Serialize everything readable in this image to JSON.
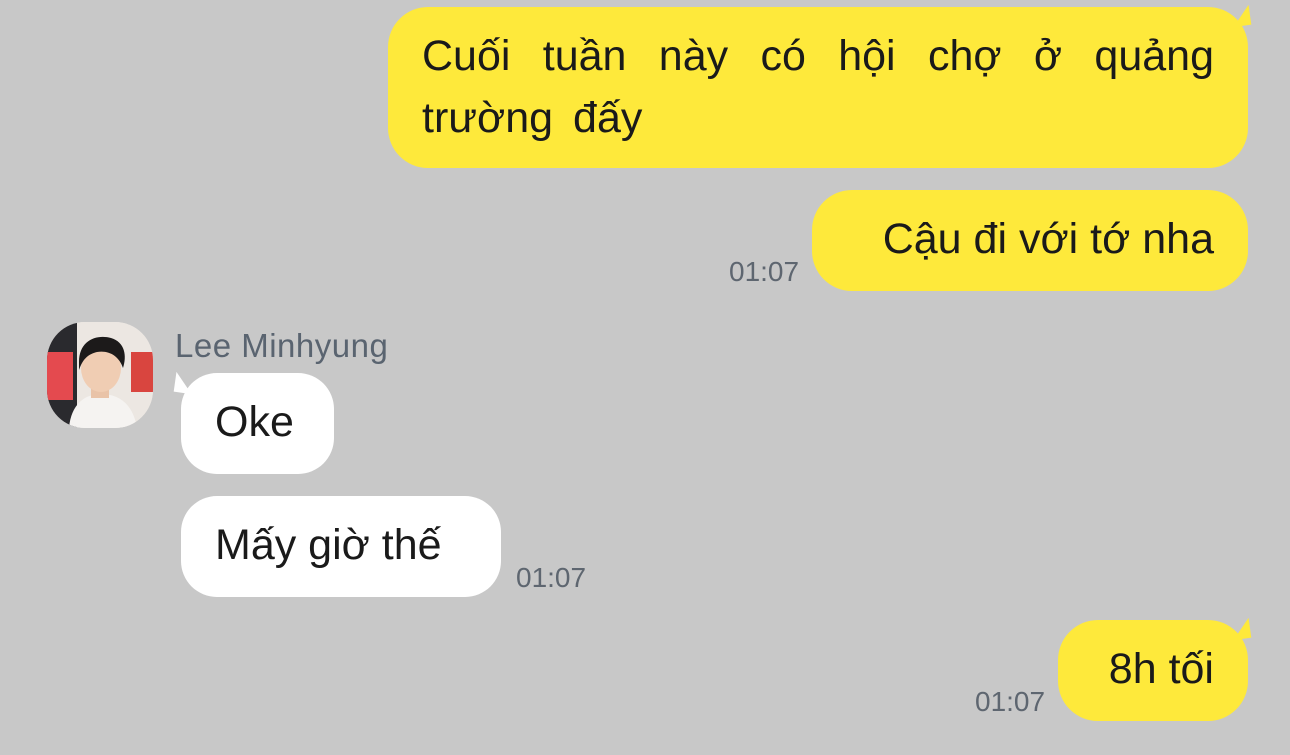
{
  "messages": [
    {
      "sender": "me",
      "text": "Cuối tuần này có hội chợ ở quảng trường đấy",
      "time": ""
    },
    {
      "sender": "me",
      "text": "Cậu đi với tớ nha",
      "time": "01:07"
    },
    {
      "sender": "Lee Minhyung",
      "text": "Oke",
      "time": ""
    },
    {
      "sender": "Lee Minhyung",
      "text": "Mấy giờ thế",
      "time": "01:07"
    },
    {
      "sender": "me",
      "text": "8h tối",
      "time": "01:07"
    }
  ],
  "contact": {
    "name": "Lee Minhyung",
    "avatar_icon": "profile-photo"
  },
  "colors": {
    "background": "#c8c8c8",
    "outgoing_bubble": "#fee93b",
    "incoming_bubble": "#ffffff",
    "timestamp_text": "#5e6670"
  }
}
